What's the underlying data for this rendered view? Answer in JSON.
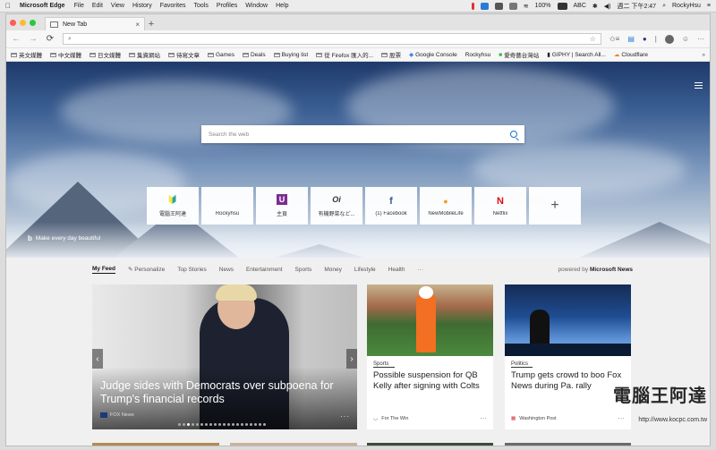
{
  "menubar": {
    "app_name": "Microsoft Edge",
    "items": [
      "File",
      "Edit",
      "View",
      "History",
      "Favorites",
      "Tools",
      "Profiles",
      "Window",
      "Help"
    ],
    "battery": "100%",
    "input": "ABC",
    "clock": "週二 下午2:47",
    "user": "RockyHsu"
  },
  "tab": {
    "title": "New Tab",
    "close": "×",
    "new": "+"
  },
  "address": {
    "placeholder": "",
    "back": "←",
    "forward": "→",
    "refresh": "⟳"
  },
  "favorites": [
    "英文媒體",
    "中文媒體",
    "日文媒體",
    "集資網站",
    "待寫文章",
    "Games",
    "Deals",
    "Buying list",
    "從 Firefox 匯入的...",
    "股票",
    "Google Console",
    "Rockyhsu",
    "愛奇藝台灣站",
    "GIPHY | Search All...",
    "Cloudflare"
  ],
  "hero": {
    "search_placeholder": "Search the web",
    "bing_caption": "Make every day beautiful",
    "bing_logo": "b"
  },
  "tiles": [
    {
      "label": "電腦王阿達",
      "glyph": "🔰",
      "color": "#3a6fb5"
    },
    {
      "label": "Rockyhsu",
      "glyph": "",
      "color": "#888888"
    },
    {
      "label": "主頁",
      "glyph": "U",
      "color": "#7b2d8e"
    },
    {
      "label": "有機野菜など...",
      "glyph": "Oi",
      "color": "#333333"
    },
    {
      "label": "(1) Facebook",
      "glyph": "f",
      "color": "#3b5998"
    },
    {
      "label": "NewMobileLife",
      "glyph": "●",
      "color": "#f0a020"
    },
    {
      "label": "Netflix",
      "glyph": "N",
      "color": "#e50914"
    }
  ],
  "add_tile": "+",
  "feed_nav": {
    "items": [
      "My Feed",
      "Personalize",
      "Top Stories",
      "News",
      "Entertainment",
      "Sports",
      "Money",
      "Lifestyle",
      "Health",
      "···"
    ],
    "powered_prefix": "powered by",
    "powered_brand": "Microsoft News"
  },
  "big_story": {
    "headline": "Judge sides with Democrats over subpoena for Trump's financial records",
    "source": "FOX News",
    "more": "···"
  },
  "cards": [
    {
      "category": "Sports",
      "title": "Possible suspension for QB Kelly after signing with Colts",
      "source": "For The Win",
      "more": "···"
    },
    {
      "category": "Politics",
      "title": "Trump gets crowd to boo Fox News during Pa. rally",
      "source": "Washington Post",
      "more": "···"
    }
  ],
  "watermark": {
    "text": "電腦王阿達",
    "url": "http://www.kocpc.com.tw"
  }
}
